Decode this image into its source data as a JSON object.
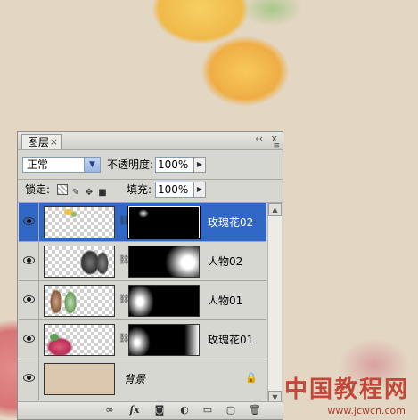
{
  "panel": {
    "tab_label": "图层",
    "tab_close": "×",
    "collapse": "‹‹",
    "close": "x",
    "menu": "≡",
    "blend_mode": "正常",
    "opacity_label": "不透明度:",
    "opacity_value": "100%",
    "lock_label": "锁定:",
    "fill_label": "填充:",
    "fill_value": "100%"
  },
  "lock_icons": [
    "transparency-lock-icon",
    "brush-lock-icon",
    "move-lock-icon",
    "padlock-icon"
  ],
  "layers": [
    {
      "name": "玫瑰花02",
      "selected": true,
      "has_mask": true
    },
    {
      "name": "人物02",
      "selected": false,
      "has_mask": true
    },
    {
      "name": "人物01",
      "selected": false,
      "has_mask": true
    },
    {
      "name": "玫瑰花01",
      "selected": false,
      "has_mask": true
    },
    {
      "name": "背景",
      "selected": false,
      "has_mask": false,
      "locked": true
    }
  ],
  "bottom_icons": [
    "link-icon",
    "fx-icon",
    "add-mask-icon",
    "adjustment-layer-icon",
    "new-group-icon",
    "new-layer-icon",
    "trash-icon"
  ],
  "bottom_glyphs": {
    "link": "∞",
    "fx": "fx",
    "mask": "◙",
    "adjust": "◐",
    "group": "▭",
    "new": "▢",
    "trash": "🗑"
  },
  "watermark": {
    "text": "中国教程网",
    "url": "www.jcwcn.com"
  },
  "colors": {
    "selected_row": "#3168c6",
    "panel_bg": "#d7d7d2",
    "background_layer_fill": "#dcc8ae"
  }
}
